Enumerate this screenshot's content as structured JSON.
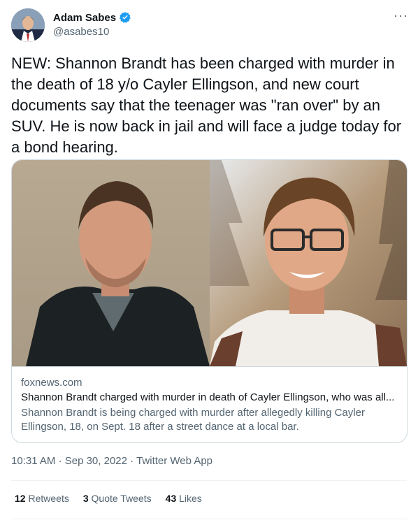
{
  "author": {
    "name": "Adam Sabes",
    "handle": "@asabes10",
    "verified": true
  },
  "more_icon": "more-horizontal-icon",
  "tweet": {
    "text": "NEW: Shannon Brandt has been charged with murder in the death of 18 y/o Cayler Ellingson, and new court documents say that the teenager was \"ran over\" by an SUV. He is now back in jail and will face a judge today for a bond hearing."
  },
  "card": {
    "domain": "foxnews.com",
    "title": "Shannon Brandt charged with murder in death of Cayler Ellingson, who was all...",
    "description": "Shannon Brandt is being charged with murder after allegedly killing Cayler Ellingson, 18, on Sept. 18 after a street dance at a local bar."
  },
  "meta": {
    "time": "10:31 AM",
    "date": "Sep 30, 2022",
    "source": "Twitter Web App",
    "sep": "·"
  },
  "stats": {
    "retweets_count": "12",
    "retweets_label": "Retweets",
    "quotes_count": "3",
    "quotes_label": "Quote Tweets",
    "likes_count": "43",
    "likes_label": "Likes"
  },
  "colors": {
    "verified": "#1d9bf0",
    "text": "#0f1419",
    "secondary": "#536471",
    "border": "#cfd9de"
  }
}
